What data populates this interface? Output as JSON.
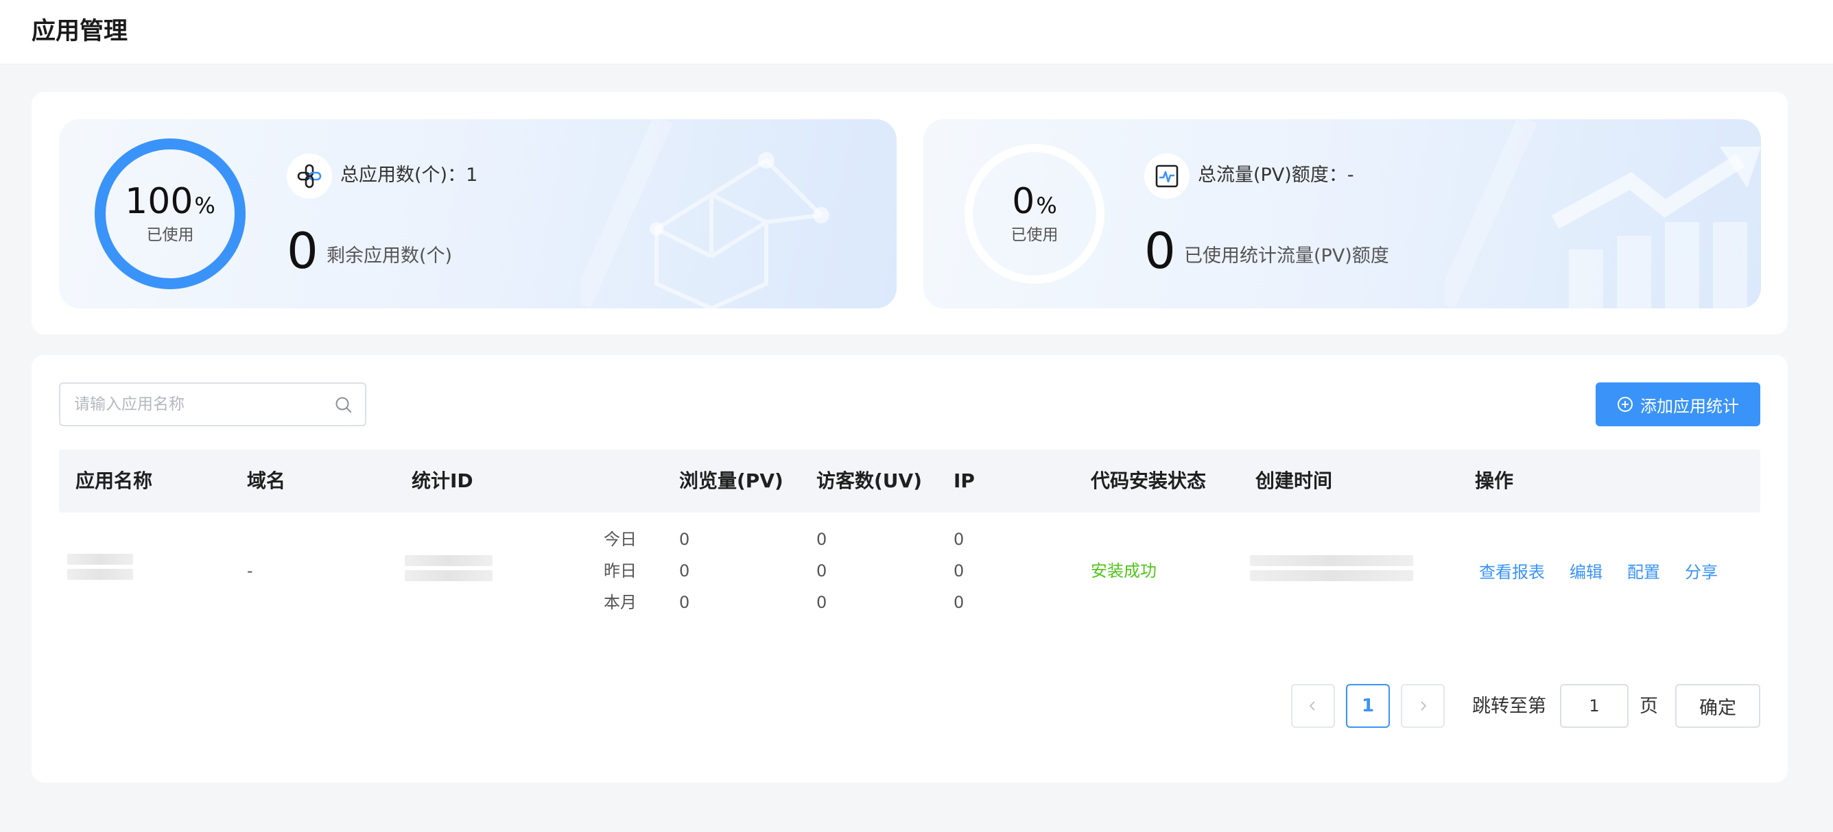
{
  "header": {
    "title": "应用管理"
  },
  "app_quota": {
    "percent": "100",
    "percent_fraction": 1.0,
    "percent_sign": "%",
    "used_label": "已使用",
    "total_label": "总应用数(个)：",
    "total_value": "1",
    "remaining_value": "0",
    "remaining_label": "剩余应用数(个)",
    "icon": "apps-icon",
    "ring_color": "#3a93f8"
  },
  "pv_quota": {
    "percent": "0",
    "percent_fraction": 0.0,
    "percent_sign": "%",
    "used_label": "已使用",
    "total_label": "总流量(PV)额度：",
    "total_value": "-",
    "used_value": "0",
    "used_desc": "已使用统计流量(PV)额度",
    "icon": "traffic-chart-icon"
  },
  "search": {
    "placeholder": "请输入应用名称"
  },
  "add_button": {
    "label": "添加应用统计"
  },
  "table": {
    "columns": [
      "应用名称",
      "域名",
      "统计ID",
      "浏览量(PV)",
      "访客数(UV)",
      "IP",
      "代码安装状态",
      "创建时间",
      "操作"
    ],
    "rows": [
      {
        "domain": "-",
        "periods": [
          {
            "label": "今日",
            "pv": "0",
            "uv": "0",
            "ip": "0"
          },
          {
            "label": "昨日",
            "pv": "0",
            "uv": "0",
            "ip": "0"
          },
          {
            "label": "本月",
            "pv": "0",
            "uv": "0",
            "ip": "0"
          }
        ],
        "status": "安装成功",
        "actions": [
          "查看报表",
          "编辑",
          "配置",
          "分享"
        ]
      }
    ]
  },
  "pagination": {
    "current_page": "1",
    "jump_label": "跳转至第",
    "jump_value": "1",
    "page_unit": "页",
    "confirm_label": "确定"
  },
  "colors": {
    "primary": "#3a93f8",
    "success": "#52c41a"
  }
}
